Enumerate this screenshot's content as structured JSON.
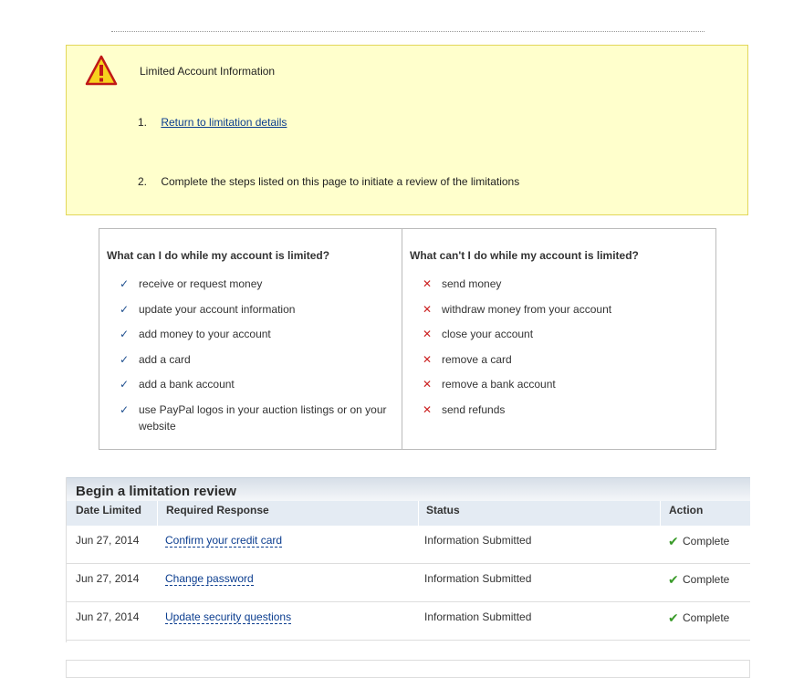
{
  "notice": {
    "title": "Limited Account Information",
    "items": [
      {
        "num": "1.",
        "text": "Return to limitation details",
        "link": true
      },
      {
        "num": "2.",
        "text": "Complete the steps listed on this page to initiate a review of the limitations",
        "link": false
      }
    ]
  },
  "can_do": {
    "title": "What can I do while my account is limited?",
    "items": [
      "receive or request money",
      "update your account information",
      "add money to your account",
      "add a card",
      "add a bank account",
      "use PayPal logos in your auction listings or on your website"
    ]
  },
  "cannot_do": {
    "title": "What can't I do while my account is limited?",
    "items": [
      "send money",
      "withdraw money from your account",
      "close your account",
      "remove a card",
      "remove a bank account",
      "send refunds"
    ]
  },
  "review": {
    "title": "Begin a limitation review",
    "columns": [
      "Date Limited",
      "Required Response",
      "Status",
      "Action"
    ],
    "rows": [
      {
        "date": "Jun 27, 2014",
        "response": "Confirm your credit card",
        "status": "Information Submitted",
        "action": "Complete"
      },
      {
        "date": "Jun 27, 2014",
        "response": "Change password",
        "status": "Information Submitted",
        "action": "Complete"
      },
      {
        "date": "Jun 27, 2014",
        "response": "Update security questions",
        "status": "Information Submitted",
        "action": "Complete"
      }
    ]
  },
  "icons": {
    "warning": "warning-triangle-icon",
    "check": "check-icon",
    "cross": "cross-icon",
    "complete": "green-check-icon"
  },
  "colors": {
    "notice_bg": "#ffffcc",
    "link": "#0b3d8f",
    "check": "#1f4f8f",
    "cross": "#cc2222",
    "complete": "#3a9b2a"
  }
}
